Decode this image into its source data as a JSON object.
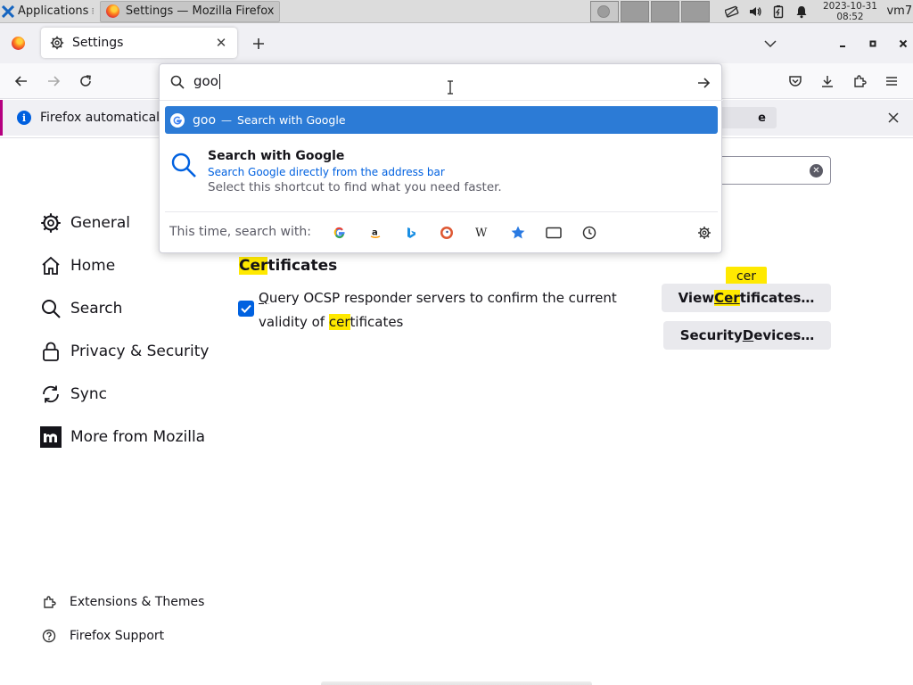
{
  "taskbar": {
    "applications_label": "Applications",
    "window_task_label": "Settings — Mozilla Firefox",
    "clock_date": "2023-10-31",
    "clock_time": "08:52",
    "user": "vm7"
  },
  "browser": {
    "tab_title": "Settings",
    "tab_close": "✕",
    "url_typed": "goo",
    "notification_text": "Firefox automatically",
    "notification_button_fragment": "e"
  },
  "url_dropdown": {
    "selected_row": {
      "query": "goo",
      "separator": "—",
      "action": "Search with Google"
    },
    "tip": {
      "title": "Search with Google",
      "subtitle": "Search Google directly from the address bar",
      "description": "Select this shortcut to find what you need faster."
    },
    "one_off_label": "This time, search with:",
    "engines": [
      "google-icon",
      "amazon-icon",
      "bing-icon",
      "duckduckgo-icon",
      "wikipedia-icon",
      "bookmarks-icon",
      "tabs-icon",
      "history-icon"
    ]
  },
  "sidebar": {
    "categories": [
      {
        "label": "General",
        "icon": "gear-icon"
      },
      {
        "label": "Home",
        "icon": "home-icon"
      },
      {
        "label": "Search",
        "icon": "search-icon"
      },
      {
        "label": "Privacy & Security",
        "icon": "lock-icon"
      },
      {
        "label": "Sync",
        "icon": "sync-icon"
      },
      {
        "label": "More from Mozilla",
        "icon": "mozilla-icon"
      }
    ],
    "footer": [
      {
        "label": "Extensions & Themes",
        "icon": "extensions-icon"
      },
      {
        "label": "Firefox Support",
        "icon": "help-icon"
      }
    ]
  },
  "certificates": {
    "title_highlight": "Cer",
    "title_rest": "tificates",
    "ocsp_label_u": "Q",
    "ocsp_label_a": "uery OCSP responder servers to confirm the current validity of ",
    "ocsp_label_hl": "cer",
    "ocsp_label_b": "tificates",
    "ocsp_checked": true,
    "view_btn_a": "View ",
    "view_btn_hl": "Cer",
    "view_btn_b": "tificates…",
    "devices_btn_a": "Security ",
    "devices_btn_u": "D",
    "devices_btn_b": "evices…",
    "search_tooltip": "cer"
  },
  "colors": {
    "accent": "#0061e0",
    "highlight": "#ffe900",
    "selected_row": "#2c7bd6"
  }
}
